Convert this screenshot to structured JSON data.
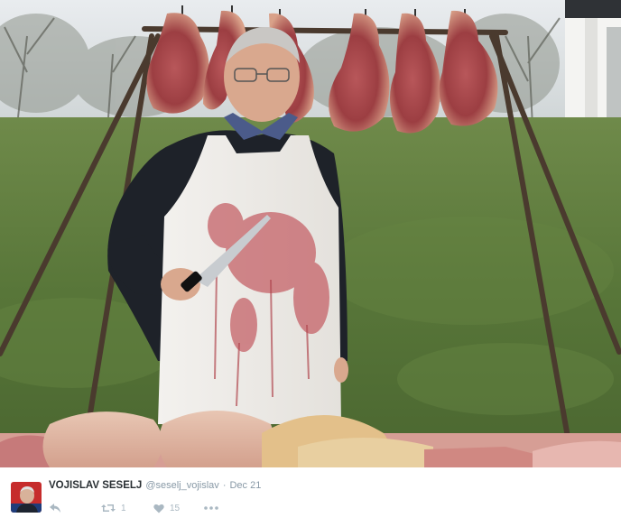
{
  "tweet": {
    "display_name": "VOJISLAV SESELJ",
    "handle": "@seselj_vojislav",
    "separator": "·",
    "date": "Dec 21"
  },
  "actions": {
    "reply_icon": "reply-icon",
    "retweet_icon": "retweet-icon",
    "retweet_count": "1",
    "like_icon": "heart-icon",
    "like_count": "15",
    "more_icon": "ellipsis-icon"
  },
  "colors": {
    "name_text": "#292f33",
    "secondary_text": "#8899a6",
    "action_icon": "#aab8c2",
    "background": "#ffffff"
  }
}
